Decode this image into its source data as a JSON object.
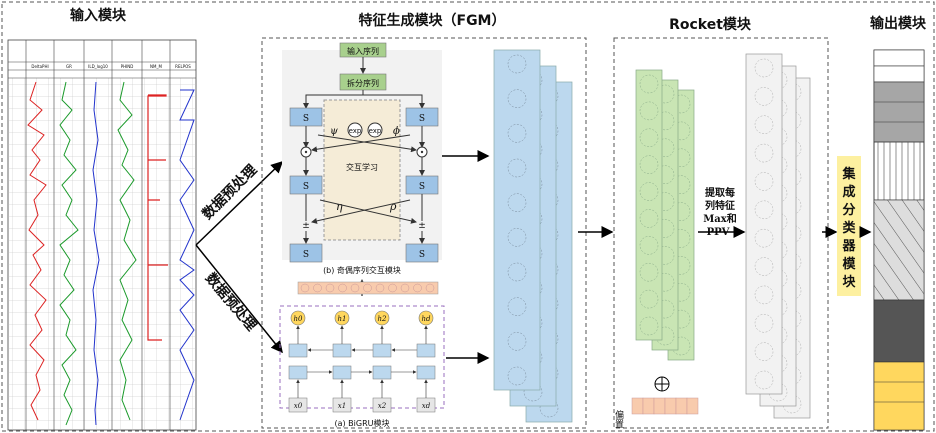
{
  "modules": {
    "input_title": "输入模块",
    "fgm_title": "特征生成模块（FGM）",
    "rocket_title": "Rocket模块",
    "output_title": "输出模块"
  },
  "preprocess": {
    "upper": "数据预处理",
    "lower": "数据预处理"
  },
  "log_headers": [
    "DeltaPHI",
    "GR",
    "ILD_log10",
    "PHIND",
    "NM_M",
    "RELPOS"
  ],
  "fgm": {
    "input_seq": "输入序列",
    "split_seq": "拆分序列",
    "s_odd": "S",
    "s_even": "S",
    "exp1": "exp",
    "exp2": "exp",
    "psi": "ψ",
    "phi": "ϕ",
    "eta": "η",
    "rho": "ρ",
    "interact": "交互学习",
    "odd_even_caption": "(b) 奇偶序列交互模块",
    "bigru_caption": "(a) BiGRU模块",
    "h_labels": [
      "h0",
      "h1",
      "h2",
      "hd"
    ],
    "x_labels": [
      "x0",
      "x1",
      "x2",
      "xd"
    ]
  },
  "rocket": {
    "extract_text": [
      "提取每",
      "列特征",
      "Max和",
      "PPV"
    ],
    "bias_label": "偏置"
  },
  "ensemble": {
    "label": [
      "集",
      "成",
      "分",
      "类",
      "器",
      "模",
      "块"
    ]
  },
  "colors": {
    "blue_feature": "#bcd8ee",
    "green_kernel": "#c9e5b4",
    "yellow_module": "#fdf0a0",
    "fgm_green": "#a8d08d",
    "fgm_blue": "#9dc3e6"
  },
  "output_layers": [
    "gray",
    "white-lines",
    "diag-hatch",
    "dark",
    "yellow"
  ]
}
